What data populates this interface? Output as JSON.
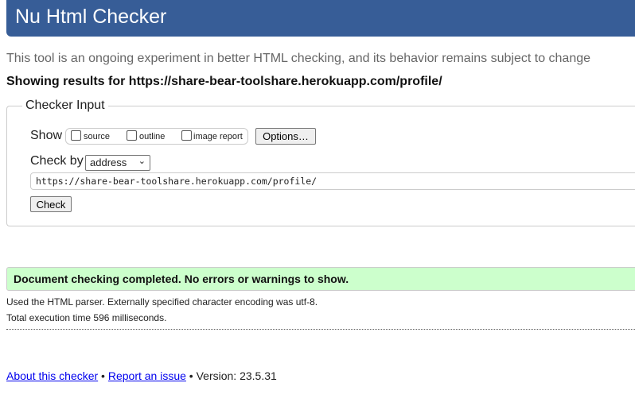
{
  "header": {
    "title": "Nu Html Checker"
  },
  "subtitle": "This tool is an ongoing experiment in better HTML checking, and its behavior remains subject to change",
  "results_for": "Showing results for https://share-bear-toolshare.herokuapp.com/profile/",
  "checker_input": {
    "legend": "Checker Input",
    "show_label": "Show",
    "show_options": [
      {
        "label": "source",
        "checked": false
      },
      {
        "label": "outline",
        "checked": false
      },
      {
        "label": "image report",
        "checked": false
      }
    ],
    "options_button": "Options…",
    "check_by_label": "Check by",
    "check_by_value": "address",
    "url_value": "https://share-bear-toolshare.herokuapp.com/profile/",
    "check_button": "Check"
  },
  "result": {
    "success": "Document checking completed. No errors or warnings to show.",
    "parser_info": "Used the HTML parser. Externally specified character encoding was utf-8.",
    "execution_time": "Total execution time 596 milliseconds."
  },
  "footer": {
    "about": "About this checker",
    "sep1": " • ",
    "report": "Report an issue",
    "version": " • Version: 23.5.31"
  },
  "colors": {
    "header": "#375d97",
    "success": "#ccffcc"
  }
}
